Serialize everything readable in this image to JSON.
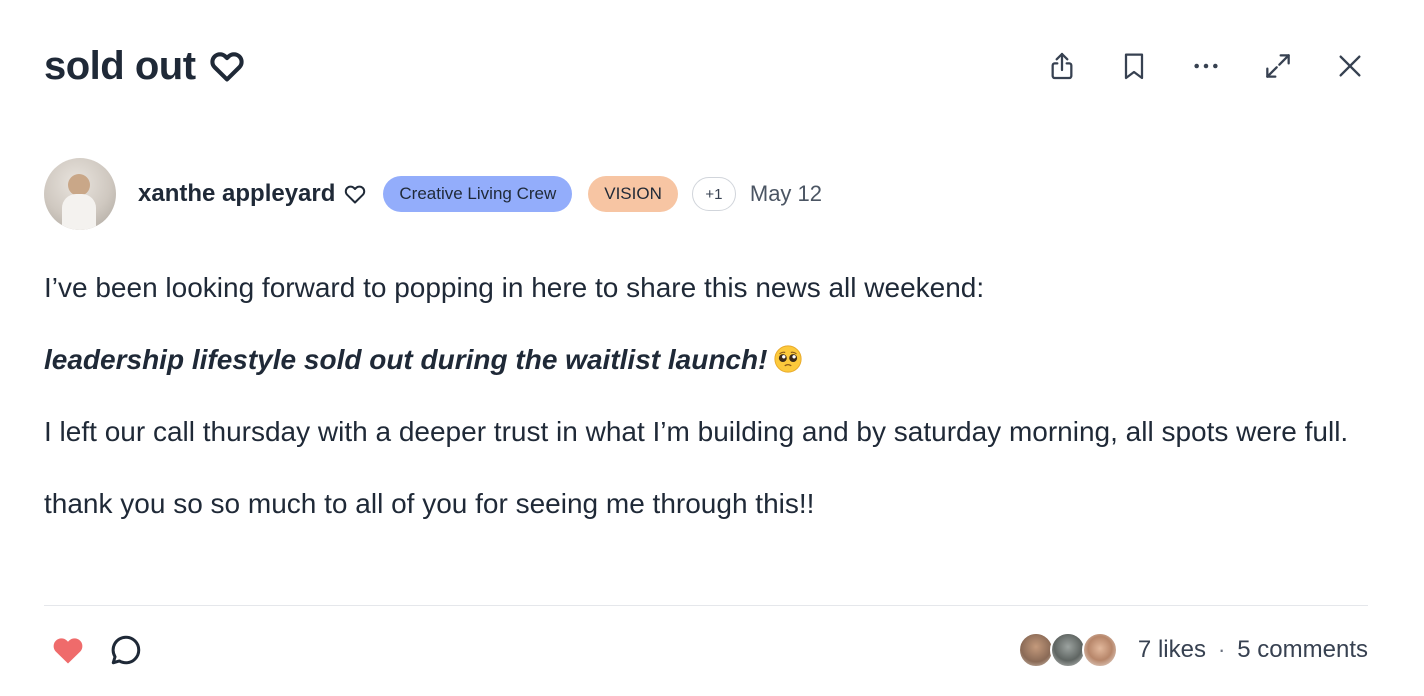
{
  "header": {
    "title": "sold out",
    "actions": [
      {
        "name": "share-icon"
      },
      {
        "name": "bookmark-icon"
      },
      {
        "name": "more-options-icon"
      },
      {
        "name": "expand-icon"
      },
      {
        "name": "close-icon"
      }
    ]
  },
  "author": {
    "name": "xanthe appleyard",
    "badges": {
      "crew": {
        "label": "Creative Living Crew",
        "color": "#93adfb"
      },
      "vision": {
        "label": "VISION",
        "color": "#f7c5a3"
      },
      "more": "+1"
    },
    "date": "May 12"
  },
  "post": {
    "paragraphs": [
      "I’ve been looking forward to popping in here to share this news all weekend:",
      "leadership lifestyle sold out during the waitlist launch!",
      "I left our call thursday with a deeper trust in what I’m building and by saturday morning, all spots were full.",
      "thank you so so much to all of you for seeing me through this!!"
    ],
    "emoji": "pleading-face-emoji"
  },
  "footer": {
    "like_color": "#ef6b6b",
    "likes": "7 likes",
    "separator": "·",
    "comments": "5 comments"
  }
}
